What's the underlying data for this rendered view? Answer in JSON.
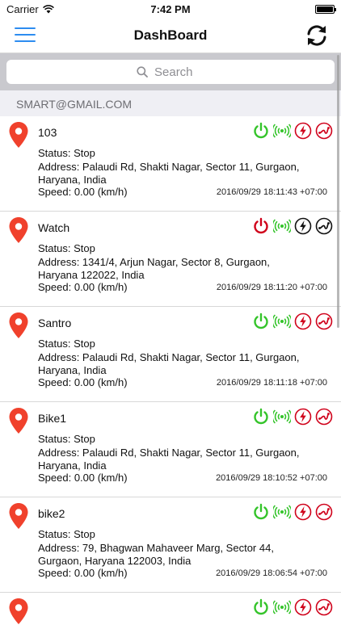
{
  "status_bar": {
    "carrier": "Carrier",
    "time": "7:42 PM"
  },
  "nav": {
    "title": "DashBoard"
  },
  "search": {
    "placeholder": "Search"
  },
  "section": {
    "header": "SMART@GMAIL.COM"
  },
  "colors": {
    "accent": "#2d8cf0",
    "pin": "#f0412c",
    "on_green": "#35c42b",
    "off_red": "#d0021b",
    "neutral_black": "#111111"
  },
  "devices": [
    {
      "name": "103",
      "power": "on",
      "acc": "red",
      "route": "red",
      "status": "Status: Stop",
      "address": "Address: Palaudi Rd, Shakti Nagar, Sector 11, Gurgaon, Haryana, India",
      "speed": "Speed: 0.00 (km/h)",
      "timestamp": "2016/09/29 18:11:43 +07:00"
    },
    {
      "name": "Watch",
      "power": "off",
      "acc": "black",
      "route": "black",
      "status": "Status: Stop",
      "address": "Address: 1341/4, Arjun Nagar, Sector 8, Gurgaon, Haryana 122022, India",
      "speed": "Speed: 0.00 (km/h)",
      "timestamp": "2016/09/29 18:11:20 +07:00"
    },
    {
      "name": "Santro",
      "power": "on",
      "acc": "red",
      "route": "red",
      "status": "Status: Stop",
      "address": "Address: Palaudi Rd, Shakti Nagar, Sector 11, Gurgaon, Haryana, India",
      "speed": "Speed: 0.00 (km/h)",
      "timestamp": "2016/09/29 18:11:18 +07:00"
    },
    {
      "name": "Bike1",
      "power": "on",
      "acc": "red",
      "route": "red",
      "status": "Status: Stop",
      "address": "Address: Palaudi Rd, Shakti Nagar, Sector 11, Gurgaon, Haryana, India",
      "speed": "Speed: 0.00 (km/h)",
      "timestamp": "2016/09/29 18:10:52 +07:00"
    },
    {
      "name": "bike2",
      "power": "on",
      "acc": "red",
      "route": "red",
      "status": "Status: Stop",
      "address": "Address: 79, Bhagwan Mahaveer Marg, Sector 44, Gurgaon, Haryana 122003, India",
      "speed": "Speed: 0.00 (km/h)",
      "timestamp": "2016/09/29 18:06:54 +07:00"
    }
  ]
}
